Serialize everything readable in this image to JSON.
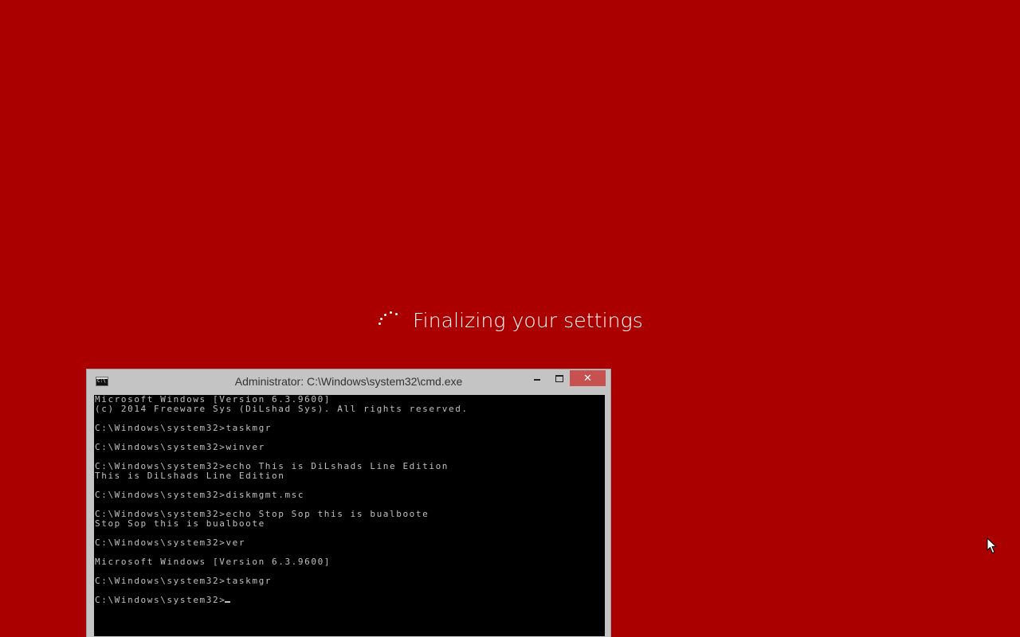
{
  "screen": {
    "background_color": "#ab0000"
  },
  "setup": {
    "status_text": "Finalizing your settings",
    "spinner_icon": "loading-dots-icon"
  },
  "cmd_window": {
    "title": "Administrator: C:\\Windows\\system32\\cmd.exe",
    "app_icon": "console-icon",
    "controls": {
      "minimize_icon": "minimize-icon",
      "maximize_icon": "maximize-icon",
      "close_label": "✕",
      "close_color": "#c7514f"
    },
    "console": {
      "background_color": "#000000",
      "text_color": "#c0c0c0",
      "output": "Microsoft Windows [Version 6.3.9600]\n(c) 2014 Freeware Sys (DiLshad Sys). All rights reserved.\n\nC:\\Windows\\system32>taskmgr\n\nC:\\Windows\\system32>winver\n\nC:\\Windows\\system32>echo This is DiLshads Line Edition\nThis is DiLshads Line Edition\n\nC:\\Windows\\system32>diskmgmt.msc\n\nC:\\Windows\\system32>echo Stop Sop this is bualboote\nStop Sop this is bualboote\n\nC:\\Windows\\system32>ver\n\nMicrosoft Windows [Version 6.3.9600]\n\nC:\\Windows\\system32>taskmgr\n\nC:\\Windows\\system32>"
    }
  },
  "pointer": {
    "icon": "arrow-cursor-icon"
  }
}
